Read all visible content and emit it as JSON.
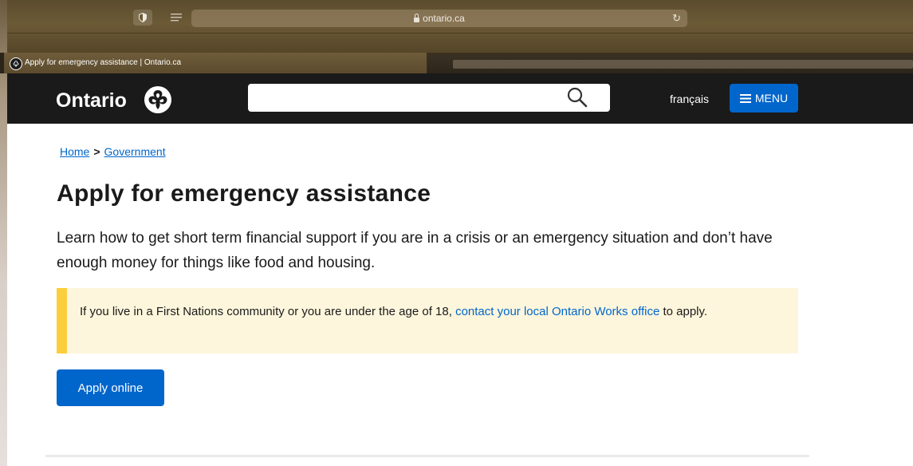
{
  "browser": {
    "url": "ontario.ca",
    "tab_title": "Apply for emergency assistance | Ontario.ca"
  },
  "header": {
    "logo_text": "Ontario",
    "search_placeholder": "",
    "language_link": "français",
    "menu_label": "MENU"
  },
  "breadcrumb": {
    "home": "Home",
    "separator": ">",
    "government": "Government"
  },
  "main": {
    "title": "Apply for emergency assistance",
    "lead": "Learn how to get short term financial support if you are in a crisis or an emergency situation and don’t have enough money for things like food and housing.",
    "callout": {
      "text_before": "If you live in a First Nations community or you are under the age of 18, ",
      "link": "contact your local Ontario Works office",
      "text_after": " to apply."
    },
    "apply_button": "Apply online"
  },
  "icons": {
    "shield": "shield-icon",
    "reader": "reader-view-icon",
    "lock": "lock-icon",
    "reload": "reload-icon",
    "search": "search-icon",
    "menu": "hamburger-icon",
    "trillium": "trillium-logo-icon"
  },
  "colors": {
    "header_bg": "#1a1a1a",
    "accent_blue": "#0066cc",
    "callout_bg": "#fef6dc",
    "callout_border": "#fbce3d"
  }
}
